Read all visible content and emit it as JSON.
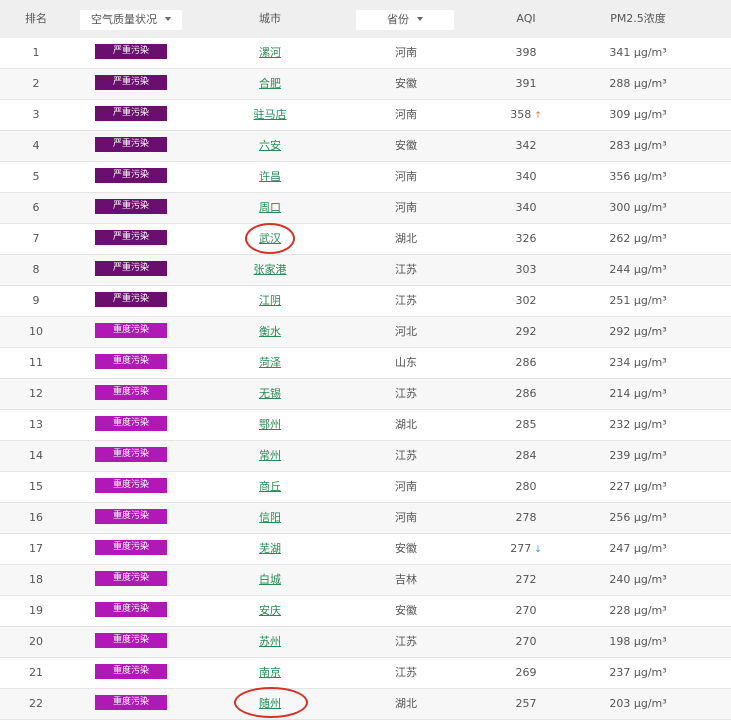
{
  "header": {
    "rank": "排名",
    "quality": "空气质量状况",
    "city": "城市",
    "province": "省份",
    "aqi": "AQI",
    "pm25": "PM2.5浓度"
  },
  "colors": {
    "severe": "#6b0f6e",
    "heavy": "#b019b6",
    "link": "#2a8a57",
    "annotation": "#d9302a"
  },
  "rows": [
    {
      "rank": "1",
      "level": "严重污染",
      "city": "漯河",
      "province": "河南",
      "aqi": "398",
      "pm25": "341 μg/m³"
    },
    {
      "rank": "2",
      "level": "严重污染",
      "city": "合肥",
      "province": "安徽",
      "aqi": "391",
      "pm25": "288 μg/m³"
    },
    {
      "rank": "3",
      "level": "严重污染",
      "city": "驻马店",
      "province": "河南",
      "aqi": "358",
      "trend": "↑",
      "pm25": "309 μg/m³"
    },
    {
      "rank": "4",
      "level": "严重污染",
      "city": "六安",
      "province": "安徽",
      "aqi": "342",
      "pm25": "283 μg/m³"
    },
    {
      "rank": "5",
      "level": "严重污染",
      "city": "许昌",
      "province": "河南",
      "aqi": "340",
      "pm25": "356 μg/m³"
    },
    {
      "rank": "6",
      "level": "严重污染",
      "city": "周口",
      "province": "河南",
      "aqi": "340",
      "pm25": "300 μg/m³"
    },
    {
      "rank": "7",
      "level": "严重污染",
      "city": "武汉",
      "province": "湖北",
      "aqi": "326",
      "pm25": "262 μg/m³"
    },
    {
      "rank": "8",
      "level": "严重污染",
      "city": "张家港",
      "province": "江苏",
      "aqi": "303",
      "pm25": "244 μg/m³"
    },
    {
      "rank": "9",
      "level": "严重污染",
      "city": "江阴",
      "province": "江苏",
      "aqi": "302",
      "pm25": "251 μg/m³"
    },
    {
      "rank": "10",
      "level": "重度污染",
      "city": "衡水",
      "province": "河北",
      "aqi": "292",
      "pm25": "292 μg/m³"
    },
    {
      "rank": "11",
      "level": "重度污染",
      "city": "菏泽",
      "province": "山东",
      "aqi": "286",
      "pm25": "234 μg/m³"
    },
    {
      "rank": "12",
      "level": "重度污染",
      "city": "无锡",
      "province": "江苏",
      "aqi": "286",
      "pm25": "214 μg/m³"
    },
    {
      "rank": "13",
      "level": "重度污染",
      "city": "鄂州",
      "province": "湖北",
      "aqi": "285",
      "pm25": "232 μg/m³"
    },
    {
      "rank": "14",
      "level": "重度污染",
      "city": "常州",
      "province": "江苏",
      "aqi": "284",
      "pm25": "239 μg/m³"
    },
    {
      "rank": "15",
      "level": "重度污染",
      "city": "商丘",
      "province": "河南",
      "aqi": "280",
      "pm25": "227 μg/m³"
    },
    {
      "rank": "16",
      "level": "重度污染",
      "city": "信阳",
      "province": "河南",
      "aqi": "278",
      "pm25": "256 μg/m³"
    },
    {
      "rank": "17",
      "level": "重度污染",
      "city": "芜湖",
      "province": "安徽",
      "aqi": "277",
      "trend": "↓",
      "pm25": "247 μg/m³"
    },
    {
      "rank": "18",
      "level": "重度污染",
      "city": "白城",
      "province": "吉林",
      "aqi": "272",
      "pm25": "240 μg/m³"
    },
    {
      "rank": "19",
      "level": "重度污染",
      "city": "安庆",
      "province": "安徽",
      "aqi": "270",
      "pm25": "228 μg/m³"
    },
    {
      "rank": "20",
      "level": "重度污染",
      "city": "苏州",
      "province": "江苏",
      "aqi": "270",
      "pm25": "198 μg/m³"
    },
    {
      "rank": "21",
      "level": "重度污染",
      "city": "南京",
      "province": "江苏",
      "aqi": "269",
      "pm25": "237 μg/m³"
    },
    {
      "rank": "22",
      "level": "重度污染",
      "city": "随州",
      "province": "湖北",
      "aqi": "257",
      "pm25": "203 μg/m³"
    }
  ]
}
